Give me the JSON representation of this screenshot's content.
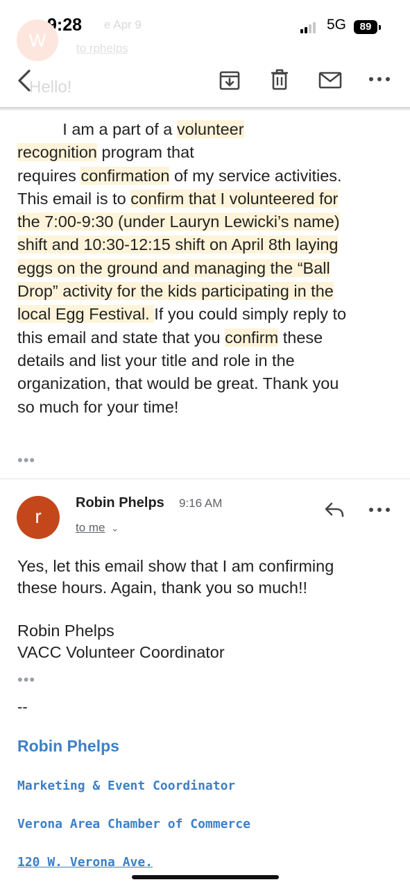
{
  "status_bar": {
    "time": "9:28",
    "network": "5G",
    "battery": "89"
  },
  "previous_header": {
    "avatar_letter": "W",
    "sender_fragment": "e  Apr 9",
    "to": "to rphelps",
    "greeting": "Hello!"
  },
  "toolbar": {
    "icons": [
      "back-arrow-icon",
      "archive-icon",
      "trash-icon",
      "mail-icon",
      "more-icon"
    ]
  },
  "original_message": {
    "lines": [
      {
        "pre": "          I am a part of a ",
        "hl": "volunteer",
        "post": ""
      },
      {
        "pre": "",
        "hl": "recognition",
        "post": " program that"
      },
      {
        "pre": "requires ",
        "hl": "confirmation",
        "post": " of my service activities."
      },
      {
        "pre": "This email is to ",
        "hl": "confirm that I volunteered for",
        "post": ""
      },
      {
        "pre": "",
        "hl": "the 7:00-9:30 (under Lauryn Lewicki’s name)",
        "post": ""
      },
      {
        "pre": "",
        "hl": "shift and 10:30-12:15 shift on April 8th laying",
        "post": ""
      },
      {
        "pre": "",
        "hl": "eggs on the ground and managing the “Ball",
        "post": ""
      },
      {
        "pre": "",
        "hl": "Drop” activity for the kids participating in the",
        "post": ""
      },
      {
        "pre": "",
        "hl": "local Egg Festival. ",
        "post": "If you could simply reply to"
      },
      {
        "pre": "this email and state that you ",
        "hl": "confirm",
        "post": " these"
      },
      {
        "pre": "details and list your title and role in the",
        "hl": "",
        "post": ""
      },
      {
        "pre": "organization, that would be great. Thank you",
        "hl": "",
        "post": ""
      },
      {
        "pre": "so much for your time!",
        "hl": "",
        "post": ""
      }
    ],
    "trimmed": "•••"
  },
  "reply": {
    "avatar_letter": "r",
    "sender": "Robin Phelps",
    "time": "9:16 AM",
    "to": "to me",
    "body_lines": [
      "Yes, let this email show that I am confirming",
      "these hours. Again, thank you so much!!"
    ],
    "sign_lines": [
      "Robin Phelps",
      "VACC Volunteer Coordinator"
    ],
    "trimmed": "•••",
    "sig_dash": "--",
    "signature": {
      "name": "Robin Phelps",
      "title": "Marketing & Event Coordinator",
      "org": "Verona Area Chamber of Commerce",
      "address": "120 W. Verona Ave."
    }
  },
  "colors": {
    "highlight": "#fff4d9",
    "avatar": "#c4471c",
    "signature_link": "#3d7fc6"
  }
}
